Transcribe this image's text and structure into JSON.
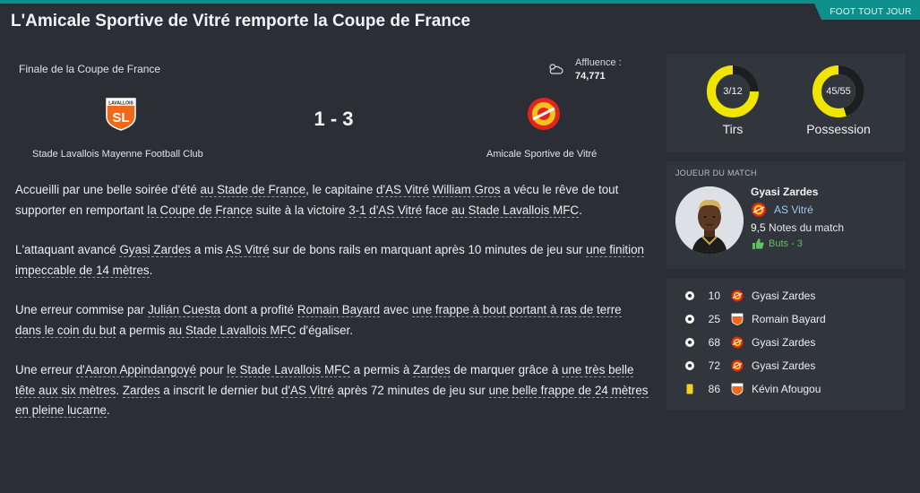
{
  "header": {
    "tag": "FOOT TOUT JOUR",
    "headline": "L'Amicale Sportive de Vitré remporte la Coupe de France"
  },
  "match": {
    "competition": "Finale de la Coupe de France",
    "attendance_label": "Affluence :",
    "attendance_value": "74,771",
    "score": "1 - 3",
    "home_team": "Stade Lavallois Mayenne Football Club",
    "away_team": "Amicale Sportive de Vitré",
    "weather_icon": "cloud-sun-icon"
  },
  "article": {
    "p1": [
      {
        "t": "Accueilli par une belle soirée d'été "
      },
      {
        "t": "au Stade de France",
        "link": true
      },
      {
        "t": ", le capitaine "
      },
      {
        "t": "d'AS Vitré",
        "link": true
      },
      {
        "t": " "
      },
      {
        "t": "William Gros",
        "link": true
      },
      {
        "t": " a vécu le rêve de tout supporter en remportant "
      },
      {
        "t": "la Coupe de France",
        "link": true
      },
      {
        "t": " suite à la victoire "
      },
      {
        "t": "3-1",
        "link": true
      },
      {
        "t": " "
      },
      {
        "t": "d'AS Vitré",
        "link": true
      },
      {
        "t": " face "
      },
      {
        "t": "au Stade Lavallois MFC",
        "link": true
      },
      {
        "t": "."
      }
    ],
    "p2": [
      {
        "t": "L'attaquant avancé "
      },
      {
        "t": "Gyasi Zardes",
        "link": true
      },
      {
        "t": " a mis "
      },
      {
        "t": "AS Vitré",
        "link": true
      },
      {
        "t": " sur de bons rails en marquant après 10 minutes de jeu sur "
      },
      {
        "t": "une finition impeccable de 14 mètres",
        "link": true
      },
      {
        "t": "."
      }
    ],
    "p3": [
      {
        "t": "Une erreur commise par "
      },
      {
        "t": "Julián Cuesta",
        "link": true
      },
      {
        "t": " dont a profité "
      },
      {
        "t": "Romain Bayard",
        "link": true
      },
      {
        "t": " avec "
      },
      {
        "t": "une frappe à bout portant à ras de terre dans le coin du but",
        "link": true
      },
      {
        "t": " a permis "
      },
      {
        "t": "au Stade Lavallois MFC",
        "link": true
      },
      {
        "t": " d'égaliser."
      }
    ],
    "p4": [
      {
        "t": "Une erreur "
      },
      {
        "t": "d'Aaron Appindangoyé",
        "link": true
      },
      {
        "t": " pour "
      },
      {
        "t": "le Stade Lavallois MFC",
        "link": true
      },
      {
        "t": " a permis à "
      },
      {
        "t": "Zardes",
        "link": true
      },
      {
        "t": " de marquer grâce à "
      },
      {
        "t": "une très belle tête aux six mètres",
        "link": true
      },
      {
        "t": ". "
      },
      {
        "t": "Zardes",
        "link": true
      },
      {
        "t": " a inscrit le dernier but "
      },
      {
        "t": "d'AS Vitré",
        "link": true
      },
      {
        "t": " après 72 minutes de jeu sur "
      },
      {
        "t": "une belle frappe de 24 mètres en pleine lucarne",
        "link": true
      },
      {
        "t": "."
      }
    ]
  },
  "stats": {
    "shots": {
      "label": "Tirs",
      "value_text": "3/12",
      "fraction": 0.25
    },
    "possession": {
      "label": "Possession",
      "value_text": "45/55",
      "fraction": 0.45
    },
    "colors": {
      "track": "#f0e500",
      "segment": "#1c1e22"
    }
  },
  "motm": {
    "title": "JOUEUR DU MATCH",
    "name": "Gyasi Zardes",
    "club": "AS Vitré",
    "rating": "9,5",
    "rating_label": "Notes du match",
    "goals": "Buts - 3"
  },
  "events": [
    {
      "type": "goal",
      "icon": "ball-icon",
      "minute": "10",
      "team": "away",
      "player": "Gyasi Zardes"
    },
    {
      "type": "goal",
      "icon": "ball-icon",
      "minute": "25",
      "team": "home",
      "player": "Romain Bayard"
    },
    {
      "type": "goal",
      "icon": "ball-icon",
      "minute": "68",
      "team": "away",
      "player": "Gyasi Zardes"
    },
    {
      "type": "goal",
      "icon": "ball-icon",
      "minute": "72",
      "team": "away",
      "player": "Gyasi Zardes"
    },
    {
      "type": "yellow",
      "icon": "yellow-card-icon",
      "minute": "86",
      "team": "home",
      "player": "Kévin Afougou"
    }
  ]
}
